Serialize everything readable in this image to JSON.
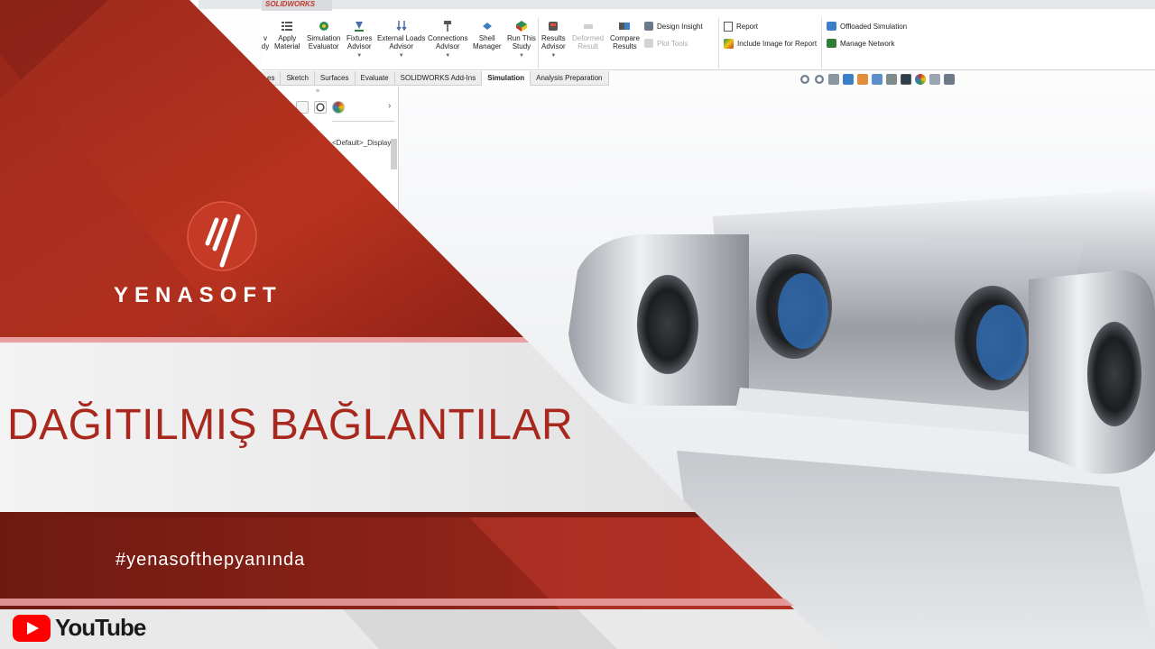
{
  "solidworks": {
    "brand_tab": "SOLIDWORKS",
    "ribbon": {
      "left_cut": [
        "v",
        "dy"
      ],
      "buttons": [
        {
          "line1": "Apply",
          "line2": "Material"
        },
        {
          "line1": "Simulation",
          "line2": "Evaluator"
        },
        {
          "line1": "Fixtures",
          "line2": "Advisor"
        },
        {
          "line1": "External Loads",
          "line2": "Advisor"
        },
        {
          "line1": "Connections",
          "line2": "Advisor"
        },
        {
          "line1": "Shell",
          "line2": "Manager"
        },
        {
          "line1": "Run This",
          "line2": "Study"
        },
        {
          "line1": "Results",
          "line2": "Advisor"
        },
        {
          "line1": "Deformed",
          "line2": "Result"
        },
        {
          "line1": "Compare",
          "line2": "Results"
        }
      ],
      "small_items": {
        "design_insight": "Design Insight",
        "plot_tools": "Plot Tools",
        "report": "Report",
        "include_image": "Include Image for Report",
        "offloaded_simulation": "Offloaded Simulation",
        "manage_network": "Manage Network"
      }
    },
    "tabs": [
      "es",
      "Sketch",
      "Surfaces",
      "Evaluate",
      "SOLIDWORKS Add-Ins",
      "Simulation",
      "Analysis Preparation"
    ],
    "active_tab": "Simulation",
    "tree_item": "<Default>_Display"
  },
  "overlay": {
    "brand_name": "YENASOFT",
    "title": "DAĞITILMIŞ BAĞLANTILAR",
    "hashtag": "#yenasofthepyanında",
    "youtube_label": "YouTube"
  },
  "colors": {
    "brand_red": "#a8281d",
    "dark_red": "#7d1d14",
    "band_light": "#ececec",
    "pink_line": "#e8a0a0",
    "youtube_red": "#ff0000"
  }
}
